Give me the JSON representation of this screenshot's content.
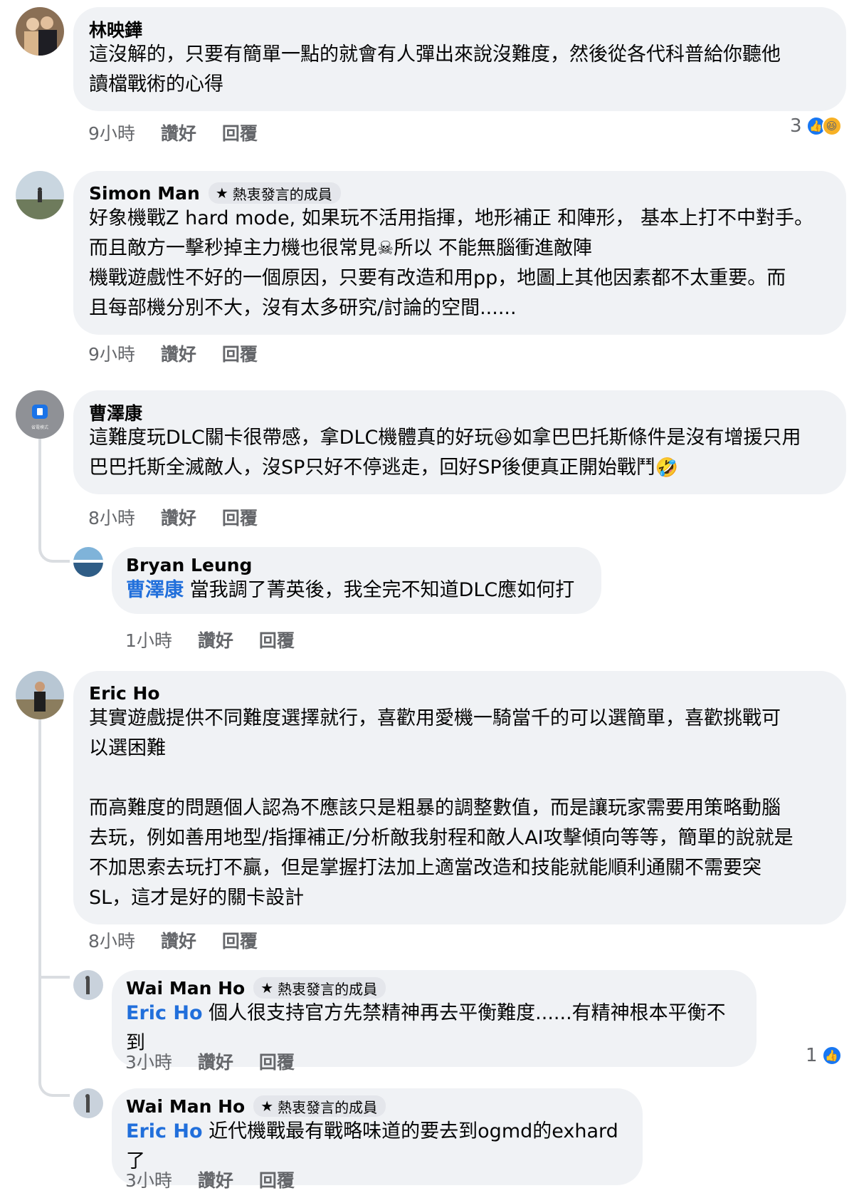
{
  "comments": [
    {
      "author": "林映鏵",
      "text": "這沒解的，只要有簡單一點的就會有人彈出來說沒難度，然後從各代科普給你聽他\n讀檔戰術的心得",
      "time": "9小時",
      "like": "讚好",
      "reply": "回覆",
      "reaction_count": "3"
    },
    {
      "author": "Simon Man",
      "badge": "熱衷發言的成員",
      "line1": "好象機戰Z hard mode, 如果玩不活用指揮，地形補正 和陣形， 基本上打不中對手。",
      "line2a": "而且敵方一擊秒掉主力機也很常見",
      "skull": "☠",
      "line2b": "所以 不能無腦衝進敵陣",
      "line3": "機戰遊戲性不好的一個原因，只要有改造和用pp，地圖上其他因素都不太重要。而\n且每部機分別不大，沒有太多研究/討論的空間......",
      "time": "9小時",
      "like": "讚好",
      "reply": "回覆"
    },
    {
      "author": "曹澤康",
      "line1a": "這難度玩DLC關卡很帶感，拿DLC機體真的好玩",
      "emoji1": "😆",
      "line1b": "如拿巴巴托斯條件是沒有增援只用",
      "line2": "巴巴托斯全滅敵人，沒SP只好不停逃走，回好SP後便真正開始戰鬥",
      "emoji2": "🤣",
      "time": "8小時",
      "like": "讚好",
      "reply": "回覆"
    },
    {
      "author": "Bryan Leung",
      "mention": "曹澤康",
      "text": " 當我調了菁英後，我全完不知道DLC應如何打",
      "time": "1小時",
      "like": "讚好",
      "reply": "回覆"
    },
    {
      "author": "Eric Ho",
      "text": "其實遊戲提供不同難度選擇就行，喜歡用愛機一騎當千的可以選簡單，喜歡挑戰可\n以選困難\n\n而高難度的問題個人認為不應該只是粗暴的調整數值，而是讓玩家需要用策略動腦\n去玩，例如善用地型/指揮補正/分析敵我射程和敵人AI攻擊傾向等等，簡單的說就是\n不加思索去玩打不贏，但是掌握打法加上適當改造和技能就能順利通關不需要突\nSL，這才是好的關卡設計",
      "time": "8小時",
      "like": "讚好",
      "reply": "回覆"
    },
    {
      "author": "Wai Man Ho",
      "badge": "熱衷發言的成員",
      "mention": "Eric Ho",
      "text": " 個人很支持官方先禁精神再去平衡難度......有精神根本平衡不到",
      "time": "3小時",
      "like": "讚好",
      "reply": "回覆",
      "reaction_count": "1"
    },
    {
      "author": "Wai Man Ho",
      "badge": "熱衷發言的成員",
      "mention": "Eric Ho",
      "text": " 近代機戰最有戰略味道的要去到ogmd的exhard了",
      "time": "3小時",
      "like": "讚好",
      "reply": "回覆"
    }
  ],
  "avatar3_text": "省電模式",
  "icons": {
    "badge": "star-icon",
    "like": "like-reaction-icon",
    "haha": "haha-reaction-icon"
  },
  "colors": {
    "bubble": "#f0f2f5",
    "mention": "#216fdb",
    "meta": "#65676b",
    "like": "#1877f2"
  }
}
